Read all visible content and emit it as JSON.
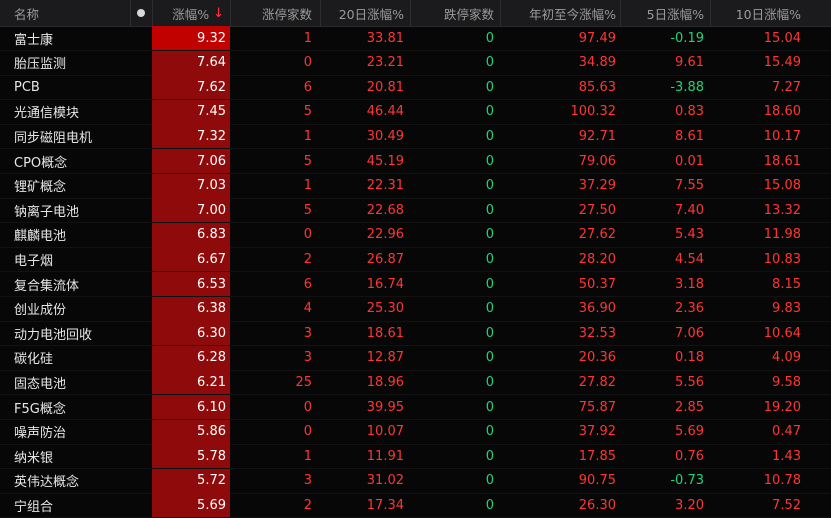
{
  "header": {
    "name": "名称",
    "chg": "涨幅%",
    "sort_arrow": "↓",
    "limit_up": "涨停家数",
    "chg20": "20日涨幅%",
    "limit_down": "跌停家数",
    "ytd": "年初至今涨幅%",
    "chg5": "5日涨幅%",
    "chg10": "10日涨幅%"
  },
  "rows": [
    {
      "name": "富士康",
      "chg": "9.32",
      "up": "1",
      "c20": "33.81",
      "down": "0",
      "ytd": "97.49",
      "c5": "-0.19",
      "c10": "15.04"
    },
    {
      "name": "胎压监测",
      "chg": "7.64",
      "up": "0",
      "c20": "23.21",
      "down": "0",
      "ytd": "34.89",
      "c5": "9.61",
      "c10": "15.49"
    },
    {
      "name": "PCB",
      "chg": "7.62",
      "up": "6",
      "c20": "20.81",
      "down": "0",
      "ytd": "85.63",
      "c5": "-3.88",
      "c10": "7.27"
    },
    {
      "name": "光通信模块",
      "chg": "7.45",
      "up": "5",
      "c20": "46.44",
      "down": "0",
      "ytd": "100.32",
      "c5": "0.83",
      "c10": "18.60"
    },
    {
      "name": "同步磁阻电机",
      "chg": "7.32",
      "up": "1",
      "c20": "30.49",
      "down": "0",
      "ytd": "92.71",
      "c5": "8.61",
      "c10": "10.17"
    },
    {
      "name": "CPO概念",
      "chg": "7.06",
      "up": "5",
      "c20": "45.19",
      "down": "0",
      "ytd": "79.06",
      "c5": "0.01",
      "c10": "18.61"
    },
    {
      "name": "锂矿概念",
      "chg": "7.03",
      "up": "1",
      "c20": "22.31",
      "down": "0",
      "ytd": "37.29",
      "c5": "7.55",
      "c10": "15.08"
    },
    {
      "name": "钠离子电池",
      "chg": "7.00",
      "up": "5",
      "c20": "22.68",
      "down": "0",
      "ytd": "27.50",
      "c5": "7.40",
      "c10": "13.32"
    },
    {
      "name": "麒麟电池",
      "chg": "6.83",
      "up": "0",
      "c20": "22.96",
      "down": "0",
      "ytd": "27.62",
      "c5": "5.43",
      "c10": "11.98"
    },
    {
      "name": "电子烟",
      "chg": "6.67",
      "up": "2",
      "c20": "26.87",
      "down": "0",
      "ytd": "28.20",
      "c5": "4.54",
      "c10": "10.83"
    },
    {
      "name": "复合集流体",
      "chg": "6.53",
      "up": "6",
      "c20": "16.74",
      "down": "0",
      "ytd": "50.37",
      "c5": "3.18",
      "c10": "8.15"
    },
    {
      "name": "创业成份",
      "chg": "6.38",
      "up": "4",
      "c20": "25.30",
      "down": "0",
      "ytd": "36.90",
      "c5": "2.36",
      "c10": "9.83"
    },
    {
      "name": "动力电池回收",
      "chg": "6.30",
      "up": "3",
      "c20": "18.61",
      "down": "0",
      "ytd": "32.53",
      "c5": "7.06",
      "c10": "10.64"
    },
    {
      "name": "碳化硅",
      "chg": "6.28",
      "up": "3",
      "c20": "12.87",
      "down": "0",
      "ytd": "20.36",
      "c5": "0.18",
      "c10": "4.09"
    },
    {
      "name": "固态电池",
      "chg": "6.21",
      "up": "25",
      "c20": "18.96",
      "down": "0",
      "ytd": "27.82",
      "c5": "5.56",
      "c10": "9.58"
    },
    {
      "name": "F5G概念",
      "chg": "6.10",
      "up": "0",
      "c20": "39.95",
      "down": "0",
      "ytd": "75.87",
      "c5": "2.85",
      "c10": "19.20"
    },
    {
      "name": "噪声防治",
      "chg": "5.86",
      "up": "0",
      "c20": "10.07",
      "down": "0",
      "ytd": "37.92",
      "c5": "5.69",
      "c10": "0.47"
    },
    {
      "name": "纳米银",
      "chg": "5.78",
      "up": "1",
      "c20": "11.91",
      "down": "0",
      "ytd": "17.85",
      "c5": "0.76",
      "c10": "1.43"
    },
    {
      "name": "英伟达概念",
      "chg": "5.72",
      "up": "3",
      "c20": "31.02",
      "down": "0",
      "ytd": "90.75",
      "c5": "-0.73",
      "c10": "10.78"
    },
    {
      "name": "宁组合",
      "chg": "5.69",
      "up": "2",
      "c20": "17.34",
      "down": "0",
      "ytd": "26.30",
      "c5": "3.20",
      "c10": "7.52"
    }
  ],
  "colors": {
    "up": "#ff3535",
    "down": "#1fd37a",
    "highlight": "#c10000",
    "highlight_dark": "#8f0b0b",
    "background": "#070707",
    "header": "#1b1b1d"
  }
}
